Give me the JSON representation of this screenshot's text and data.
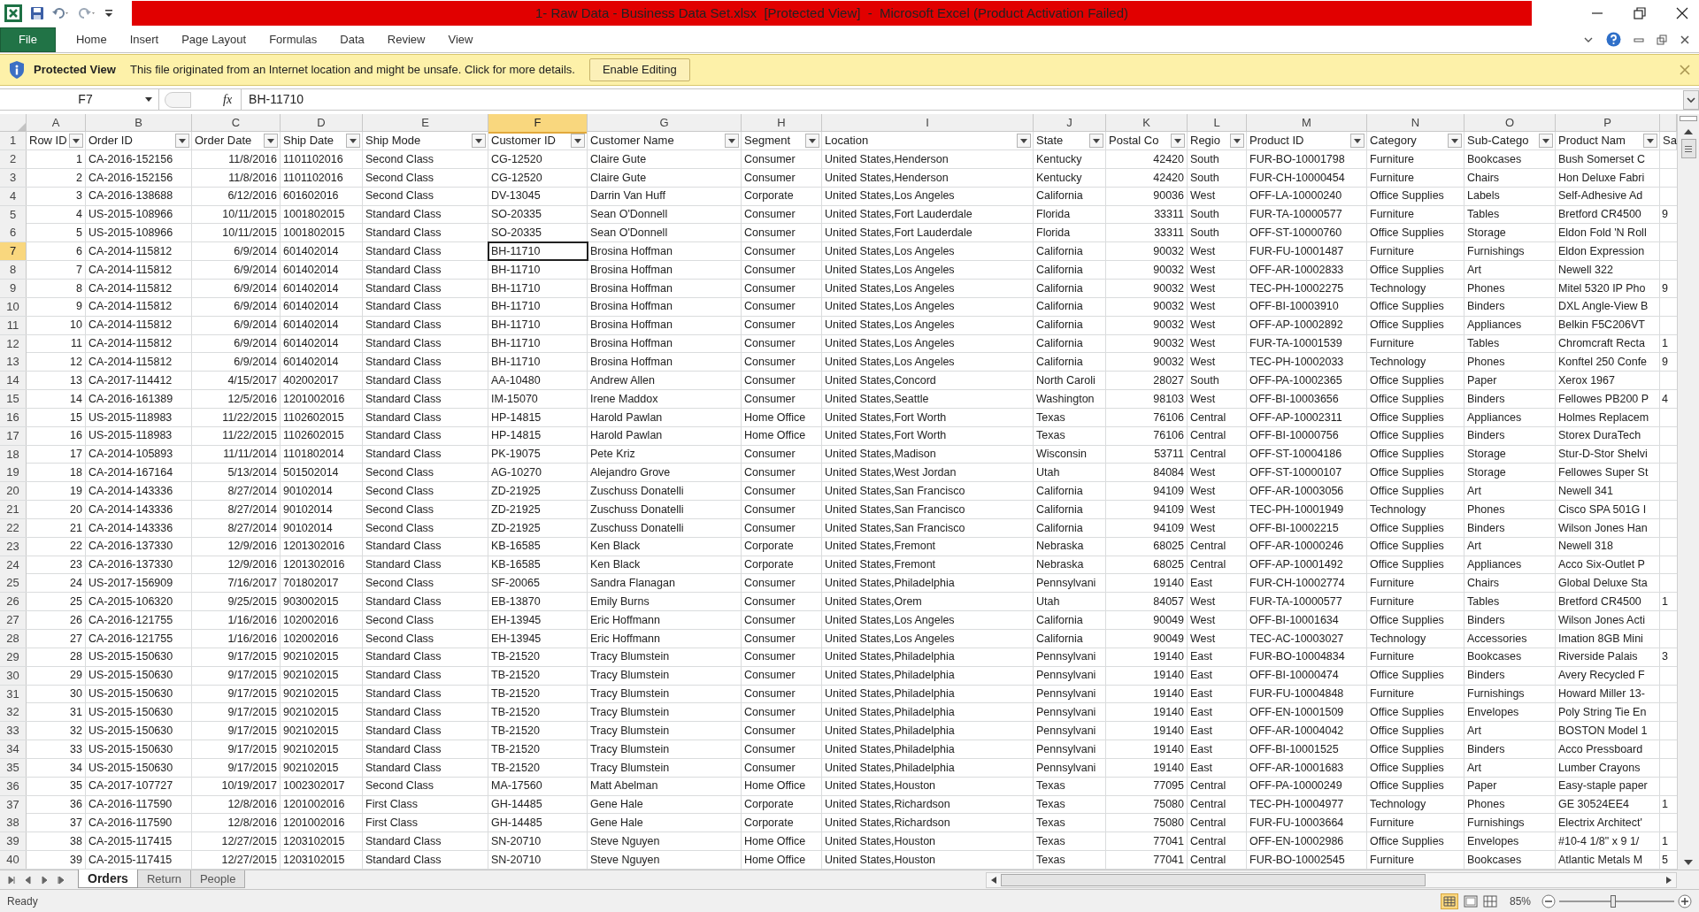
{
  "window": {
    "title": "1- Raw Data - Business Data Set.xlsx  [Protected View]  -  Microsoft Excel (Product Activation Failed)"
  },
  "ribbon_tabs": [
    {
      "label": "File",
      "selected": true
    },
    {
      "label": "Home",
      "selected": false
    },
    {
      "label": "Insert",
      "selected": false
    },
    {
      "label": "Page Layout",
      "selected": false
    },
    {
      "label": "Formulas",
      "selected": false
    },
    {
      "label": "Data",
      "selected": false
    },
    {
      "label": "Review",
      "selected": false
    },
    {
      "label": "View",
      "selected": false
    }
  ],
  "protected_view": {
    "title": "Protected View",
    "message": "This file originated from an Internet location and might be unsafe. Click for more details.",
    "button": "Enable Editing"
  },
  "formula_bar": {
    "name_box": "F7",
    "function_label": "fx",
    "value": "BH-11710"
  },
  "columns": [
    {
      "letter": "A",
      "header": "Row ID",
      "kind": "number",
      "selected": false
    },
    {
      "letter": "B",
      "header": "Order ID",
      "kind": "text",
      "selected": false
    },
    {
      "letter": "C",
      "header": "Order Date",
      "kind": "number",
      "selected": false
    },
    {
      "letter": "D",
      "header": "Ship Date",
      "kind": "text",
      "selected": false
    },
    {
      "letter": "E",
      "header": "Ship Mode",
      "kind": "text",
      "selected": false
    },
    {
      "letter": "F",
      "header": "Customer ID",
      "kind": "text",
      "selected": true
    },
    {
      "letter": "G",
      "header": "Customer Name",
      "kind": "text",
      "selected": false
    },
    {
      "letter": "H",
      "header": "Segment",
      "kind": "text",
      "selected": false
    },
    {
      "letter": "I",
      "header": "Location",
      "kind": "text",
      "selected": false
    },
    {
      "letter": "J",
      "header": "State",
      "kind": "text",
      "selected": false
    },
    {
      "letter": "K",
      "header": "Postal Co",
      "kind": "number",
      "selected": false
    },
    {
      "letter": "L",
      "header": "Regio",
      "kind": "text",
      "selected": false
    },
    {
      "letter": "M",
      "header": "Product ID",
      "kind": "text",
      "selected": false
    },
    {
      "letter": "N",
      "header": "Category",
      "kind": "text",
      "selected": false
    },
    {
      "letter": "O",
      "header": "Sub-Catego",
      "kind": "text",
      "selected": false
    },
    {
      "letter": "P",
      "header": "Product Nam",
      "kind": "text",
      "selected": false
    },
    {
      "header": "Sa",
      "kind": "text",
      "selected": false
    }
  ],
  "header_row_number": "1",
  "rows": [
    {
      "number": "2",
      "selected": false,
      "cells": [
        "1",
        "CA-2016-152156",
        "11/8/2016",
        "1101102016",
        "Second Class",
        "CG-12520",
        "Claire Gute",
        "Consumer",
        "United States,Henderson",
        "Kentucky",
        "42420",
        "South",
        "FUR-BO-10001798",
        "Furniture",
        "Bookcases",
        "Bush Somerset C"
      ]
    },
    {
      "number": "3",
      "selected": false,
      "cells": [
        "2",
        "CA-2016-152156",
        "11/8/2016",
        "1101102016",
        "Second Class",
        "CG-12520",
        "Claire Gute",
        "Consumer",
        "United States,Henderson",
        "Kentucky",
        "42420",
        "South",
        "FUR-CH-10000454",
        "Furniture",
        "Chairs",
        "Hon Deluxe Fabri"
      ]
    },
    {
      "number": "4",
      "selected": false,
      "cells": [
        "3",
        "CA-2016-138688",
        "6/12/2016",
        "601602016",
        "Second Class",
        "DV-13045",
        "Darrin Van Huff",
        "Corporate",
        "United States,Los Angeles",
        "California",
        "90036",
        "West",
        "OFF-LA-10000240",
        "Office Supplies",
        "Labels",
        "Self-Adhesive Ad"
      ]
    },
    {
      "number": "5",
      "selected": false,
      "cells": [
        "4",
        "US-2015-108966",
        "10/11/2015",
        "1001802015",
        "Standard Class",
        "SO-20335",
        "Sean O'Donnell",
        "Consumer",
        "United States,Fort Lauderdale",
        "Florida",
        "33311",
        "South",
        "FUR-TA-10000577",
        "Furniture",
        "Tables",
        "Bretford CR4500"
      ],
      "q_cell": "9"
    },
    {
      "number": "6",
      "selected": false,
      "cells": [
        "5",
        "US-2015-108966",
        "10/11/2015",
        "1001802015",
        "Standard Class",
        "SO-20335",
        "Sean O'Donnell",
        "Consumer",
        "United States,Fort Lauderdale",
        "Florida",
        "33311",
        "South",
        "OFF-ST-10000760",
        "Office Supplies",
        "Storage",
        "Eldon Fold 'N Roll"
      ]
    },
    {
      "number": "7",
      "selected": true,
      "cells": [
        "6",
        "CA-2014-115812",
        "6/9/2014",
        "601402014",
        "Standard Class",
        "BH-11710",
        "Brosina Hoffman",
        "Consumer",
        "United States,Los Angeles",
        "California",
        "90032",
        "West",
        "FUR-FU-10001487",
        "Furniture",
        "Furnishings",
        "Eldon Expression"
      ]
    },
    {
      "number": "8",
      "selected": false,
      "cells": [
        "7",
        "CA-2014-115812",
        "6/9/2014",
        "601402014",
        "Standard Class",
        "BH-11710",
        "Brosina Hoffman",
        "Consumer",
        "United States,Los Angeles",
        "California",
        "90032",
        "West",
        "OFF-AR-10002833",
        "Office Supplies",
        "Art",
        "Newell 322"
      ]
    },
    {
      "number": "9",
      "selected": false,
      "cells": [
        "8",
        "CA-2014-115812",
        "6/9/2014",
        "601402014",
        "Standard Class",
        "BH-11710",
        "Brosina Hoffman",
        "Consumer",
        "United States,Los Angeles",
        "California",
        "90032",
        "West",
        "TEC-PH-10002275",
        "Technology",
        "Phones",
        "Mitel 5320 IP Pho"
      ],
      "q_cell": "9"
    },
    {
      "number": "10",
      "selected": false,
      "cells": [
        "9",
        "CA-2014-115812",
        "6/9/2014",
        "601402014",
        "Standard Class",
        "BH-11710",
        "Brosina Hoffman",
        "Consumer",
        "United States,Los Angeles",
        "California",
        "90032",
        "West",
        "OFF-BI-10003910",
        "Office Supplies",
        "Binders",
        "DXL Angle-View B"
      ]
    },
    {
      "number": "11",
      "selected": false,
      "cells": [
        "10",
        "CA-2014-115812",
        "6/9/2014",
        "601402014",
        "Standard Class",
        "BH-11710",
        "Brosina Hoffman",
        "Consumer",
        "United States,Los Angeles",
        "California",
        "90032",
        "West",
        "OFF-AP-10002892",
        "Office Supplies",
        "Appliances",
        "Belkin F5C206VT"
      ]
    },
    {
      "number": "12",
      "selected": false,
      "cells": [
        "11",
        "CA-2014-115812",
        "6/9/2014",
        "601402014",
        "Standard Class",
        "BH-11710",
        "Brosina Hoffman",
        "Consumer",
        "United States,Los Angeles",
        "California",
        "90032",
        "West",
        "FUR-TA-10001539",
        "Furniture",
        "Tables",
        "Chromcraft Recta"
      ],
      "q_cell": "1"
    },
    {
      "number": "13",
      "selected": false,
      "cells": [
        "12",
        "CA-2014-115812",
        "6/9/2014",
        "601402014",
        "Standard Class",
        "BH-11710",
        "Brosina Hoffman",
        "Consumer",
        "United States,Los Angeles",
        "California",
        "90032",
        "West",
        "TEC-PH-10002033",
        "Technology",
        "Phones",
        "Konftel 250 Confe"
      ],
      "q_cell": "9"
    },
    {
      "number": "14",
      "selected": false,
      "cells": [
        "13",
        "CA-2017-114412",
        "4/15/2017",
        "402002017",
        "Standard Class",
        "AA-10480",
        "Andrew Allen",
        "Consumer",
        "United States,Concord",
        "North Caroli",
        "28027",
        "South",
        "OFF-PA-10002365",
        "Office Supplies",
        "Paper",
        "Xerox 1967"
      ]
    },
    {
      "number": "15",
      "selected": false,
      "cells": [
        "14",
        "CA-2016-161389",
        "12/5/2016",
        "1201002016",
        "Standard Class",
        "IM-15070",
        "Irene Maddox",
        "Consumer",
        "United States,Seattle",
        "Washington",
        "98103",
        "West",
        "OFF-BI-10003656",
        "Office Supplies",
        "Binders",
        "Fellowes PB200 P"
      ],
      "q_cell": "4"
    },
    {
      "number": "16",
      "selected": false,
      "cells": [
        "15",
        "US-2015-118983",
        "11/22/2015",
        "1102602015",
        "Standard Class",
        "HP-14815",
        "Harold Pawlan",
        "Home Office",
        "United States,Fort Worth",
        "Texas",
        "76106",
        "Central",
        "OFF-AP-10002311",
        "Office Supplies",
        "Appliances",
        "Holmes Replacem"
      ]
    },
    {
      "number": "17",
      "selected": false,
      "cells": [
        "16",
        "US-2015-118983",
        "11/22/2015",
        "1102602015",
        "Standard Class",
        "HP-14815",
        "Harold Pawlan",
        "Home Office",
        "United States,Fort Worth",
        "Texas",
        "76106",
        "Central",
        "OFF-BI-10000756",
        "Office Supplies",
        "Binders",
        "Storex DuraTech"
      ]
    },
    {
      "number": "18",
      "selected": false,
      "cells": [
        "17",
        "CA-2014-105893",
        "11/11/2014",
        "1101802014",
        "Standard Class",
        "PK-19075",
        "Pete Kriz",
        "Consumer",
        "United States,Madison",
        "Wisconsin",
        "53711",
        "Central",
        "OFF-ST-10004186",
        "Office Supplies",
        "Storage",
        "Stur-D-Stor Shelvi"
      ]
    },
    {
      "number": "19",
      "selected": false,
      "cells": [
        "18",
        "CA-2014-167164",
        "5/13/2014",
        "501502014",
        "Second Class",
        "AG-10270",
        "Alejandro Grove",
        "Consumer",
        "United States,West Jordan",
        "Utah",
        "84084",
        "West",
        "OFF-ST-10000107",
        "Office Supplies",
        "Storage",
        "Fellowes Super St"
      ]
    },
    {
      "number": "20",
      "selected": false,
      "cells": [
        "19",
        "CA-2014-143336",
        "8/27/2014",
        "90102014",
        "Second Class",
        "ZD-21925",
        "Zuschuss Donatelli",
        "Consumer",
        "United States,San Francisco",
        "California",
        "94109",
        "West",
        "OFF-AR-10003056",
        "Office Supplies",
        "Art",
        "Newell 341"
      ]
    },
    {
      "number": "21",
      "selected": false,
      "cells": [
        "20",
        "CA-2014-143336",
        "8/27/2014",
        "90102014",
        "Second Class",
        "ZD-21925",
        "Zuschuss Donatelli",
        "Consumer",
        "United States,San Francisco",
        "California",
        "94109",
        "West",
        "TEC-PH-10001949",
        "Technology",
        "Phones",
        "Cisco SPA 501G I"
      ]
    },
    {
      "number": "22",
      "selected": false,
      "cells": [
        "21",
        "CA-2014-143336",
        "8/27/2014",
        "90102014",
        "Second Class",
        "ZD-21925",
        "Zuschuss Donatelli",
        "Consumer",
        "United States,San Francisco",
        "California",
        "94109",
        "West",
        "OFF-BI-10002215",
        "Office Supplies",
        "Binders",
        "Wilson Jones Han"
      ]
    },
    {
      "number": "23",
      "selected": false,
      "cells": [
        "22",
        "CA-2016-137330",
        "12/9/2016",
        "1201302016",
        "Standard Class",
        "KB-16585",
        "Ken Black",
        "Corporate",
        "United States,Fremont",
        "Nebraska",
        "68025",
        "Central",
        "OFF-AR-10000246",
        "Office Supplies",
        "Art",
        "Newell 318"
      ]
    },
    {
      "number": "24",
      "selected": false,
      "cells": [
        "23",
        "CA-2016-137330",
        "12/9/2016",
        "1201302016",
        "Standard Class",
        "KB-16585",
        "Ken Black",
        "Corporate",
        "United States,Fremont",
        "Nebraska",
        "68025",
        "Central",
        "OFF-AP-10001492",
        "Office Supplies",
        "Appliances",
        "Acco Six-Outlet P"
      ]
    },
    {
      "number": "25",
      "selected": false,
      "cells": [
        "24",
        "US-2017-156909",
        "7/16/2017",
        "701802017",
        "Second Class",
        "SF-20065",
        "Sandra Flanagan",
        "Consumer",
        "United States,Philadelphia",
        "Pennsylvani",
        "19140",
        "East",
        "FUR-CH-10002774",
        "Furniture",
        "Chairs",
        "Global Deluxe Sta"
      ]
    },
    {
      "number": "26",
      "selected": false,
      "cells": [
        "25",
        "CA-2015-106320",
        "9/25/2015",
        "903002015",
        "Standard Class",
        "EB-13870",
        "Emily Burns",
        "Consumer",
        "United States,Orem",
        "Utah",
        "84057",
        "West",
        "FUR-TA-10000577",
        "Furniture",
        "Tables",
        "Bretford CR4500"
      ],
      "q_cell": "1"
    },
    {
      "number": "27",
      "selected": false,
      "cells": [
        "26",
        "CA-2016-121755",
        "1/16/2016",
        "102002016",
        "Second Class",
        "EH-13945",
        "Eric Hoffmann",
        "Consumer",
        "United States,Los Angeles",
        "California",
        "90049",
        "West",
        "OFF-BI-10001634",
        "Office Supplies",
        "Binders",
        "Wilson Jones Acti"
      ]
    },
    {
      "number": "28",
      "selected": false,
      "cells": [
        "27",
        "CA-2016-121755",
        "1/16/2016",
        "102002016",
        "Second Class",
        "EH-13945",
        "Eric Hoffmann",
        "Consumer",
        "United States,Los Angeles",
        "California",
        "90049",
        "West",
        "TEC-AC-10003027",
        "Technology",
        "Accessories",
        "Imation 8GB Mini"
      ]
    },
    {
      "number": "29",
      "selected": false,
      "cells": [
        "28",
        "US-2015-150630",
        "9/17/2015",
        "902102015",
        "Standard Class",
        "TB-21520",
        "Tracy Blumstein",
        "Consumer",
        "United States,Philadelphia",
        "Pennsylvani",
        "19140",
        "East",
        "FUR-BO-10004834",
        "Furniture",
        "Bookcases",
        "Riverside Palais"
      ],
      "q_cell": "3"
    },
    {
      "number": "30",
      "selected": false,
      "cells": [
        "29",
        "US-2015-150630",
        "9/17/2015",
        "902102015",
        "Standard Class",
        "TB-21520",
        "Tracy Blumstein",
        "Consumer",
        "United States,Philadelphia",
        "Pennsylvani",
        "19140",
        "East",
        "OFF-BI-10000474",
        "Office Supplies",
        "Binders",
        "Avery Recycled F"
      ]
    },
    {
      "number": "31",
      "selected": false,
      "cells": [
        "30",
        "US-2015-150630",
        "9/17/2015",
        "902102015",
        "Standard Class",
        "TB-21520",
        "Tracy Blumstein",
        "Consumer",
        "United States,Philadelphia",
        "Pennsylvani",
        "19140",
        "East",
        "FUR-FU-10004848",
        "Furniture",
        "Furnishings",
        "Howard Miller 13-"
      ]
    },
    {
      "number": "32",
      "selected": false,
      "cells": [
        "31",
        "US-2015-150630",
        "9/17/2015",
        "902102015",
        "Standard Class",
        "TB-21520",
        "Tracy Blumstein",
        "Consumer",
        "United States,Philadelphia",
        "Pennsylvani",
        "19140",
        "East",
        "OFF-EN-10001509",
        "Office Supplies",
        "Envelopes",
        "Poly String Tie En"
      ]
    },
    {
      "number": "33",
      "selected": false,
      "cells": [
        "32",
        "US-2015-150630",
        "9/17/2015",
        "902102015",
        "Standard Class",
        "TB-21520",
        "Tracy Blumstein",
        "Consumer",
        "United States,Philadelphia",
        "Pennsylvani",
        "19140",
        "East",
        "OFF-AR-10004042",
        "Office Supplies",
        "Art",
        "BOSTON Model 1"
      ]
    },
    {
      "number": "34",
      "selected": false,
      "cells": [
        "33",
        "US-2015-150630",
        "9/17/2015",
        "902102015",
        "Standard Class",
        "TB-21520",
        "Tracy Blumstein",
        "Consumer",
        "United States,Philadelphia",
        "Pennsylvani",
        "19140",
        "East",
        "OFF-BI-10001525",
        "Office Supplies",
        "Binders",
        "Acco Pressboard"
      ]
    },
    {
      "number": "35",
      "selected": false,
      "cells": [
        "34",
        "US-2015-150630",
        "9/17/2015",
        "902102015",
        "Standard Class",
        "TB-21520",
        "Tracy Blumstein",
        "Consumer",
        "United States,Philadelphia",
        "Pennsylvani",
        "19140",
        "East",
        "OFF-AR-10001683",
        "Office Supplies",
        "Art",
        "Lumber Crayons"
      ]
    },
    {
      "number": "36",
      "selected": false,
      "cells": [
        "35",
        "CA-2017-107727",
        "10/19/2017",
        "1002302017",
        "Second Class",
        "MA-17560",
        "Matt Abelman",
        "Home Office",
        "United States,Houston",
        "Texas",
        "77095",
        "Central",
        "OFF-PA-10000249",
        "Office Supplies",
        "Paper",
        "Easy-staple paper"
      ]
    },
    {
      "number": "37",
      "selected": false,
      "cells": [
        "36",
        "CA-2016-117590",
        "12/8/2016",
        "1201002016",
        "First Class",
        "GH-14485",
        "Gene Hale",
        "Corporate",
        "United States,Richardson",
        "Texas",
        "75080",
        "Central",
        "TEC-PH-10004977",
        "Technology",
        "Phones",
        "GE 30524EE4"
      ],
      "q_cell": "1"
    },
    {
      "number": "38",
      "selected": false,
      "cells": [
        "37",
        "CA-2016-117590",
        "12/8/2016",
        "1201002016",
        "First Class",
        "GH-14485",
        "Gene Hale",
        "Corporate",
        "United States,Richardson",
        "Texas",
        "75080",
        "Central",
        "FUR-FU-10003664",
        "Furniture",
        "Furnishings",
        "Electrix Architect'"
      ]
    },
    {
      "number": "39",
      "selected": false,
      "cells": [
        "38",
        "CA-2015-117415",
        "12/27/2015",
        "1203102015",
        "Standard Class",
        "SN-20710",
        "Steve Nguyen",
        "Home Office",
        "United States,Houston",
        "Texas",
        "77041",
        "Central",
        "OFF-EN-10002986",
        "Office Supplies",
        "Envelopes",
        "#10-4 1/8\" x 9 1/"
      ],
      "q_cell": "1"
    },
    {
      "number": "40",
      "selected": false,
      "cells": [
        "39",
        "CA-2015-117415",
        "12/27/2015",
        "1203102015",
        "Standard Class",
        "SN-20710",
        "Steve Nguyen",
        "Home Office",
        "United States,Houston",
        "Texas",
        "77041",
        "Central",
        "FUR-BO-10002545",
        "Furniture",
        "Bookcases",
        "Atlantic Metals M"
      ],
      "q_cell": "5"
    }
  ],
  "sheet_tabs": [
    {
      "label": "Orders",
      "selected": true
    },
    {
      "label": "Return",
      "selected": false
    },
    {
      "label": "People",
      "selected": false
    }
  ],
  "status_bar": {
    "status": "Ready",
    "zoom": "85%",
    "zoom_slider": {
      "level": 0.47
    }
  }
}
